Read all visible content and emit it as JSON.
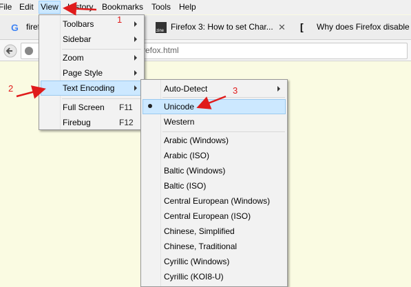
{
  "menubar": {
    "file": "File",
    "edit": "Edit",
    "view": "View",
    "history": "History",
    "bookmarks": "Bookmarks",
    "tools": "Tools",
    "help": "Help"
  },
  "tabs": {
    "t1": "firef",
    "t2": "Firefox 3: How to set Char...",
    "t3": "Why does Firefox disable t"
  },
  "url": {
    "text": "firefox.html"
  },
  "view_menu": {
    "toolbars": "Toolbars",
    "sidebar": "Sidebar",
    "zoom": "Zoom",
    "page_style": "Page Style",
    "text_encoding": "Text Encoding",
    "full_screen": "Full Screen",
    "full_screen_sc": "F11",
    "firebug": "Firebug",
    "firebug_sc": "F12"
  },
  "encoding_menu": {
    "auto_detect": "Auto-Detect",
    "unicode": "Unicode",
    "western": "Western",
    "items": [
      "Arabic (Windows)",
      "Arabic (ISO)",
      "Baltic (Windows)",
      "Baltic (ISO)",
      "Central European (Windows)",
      "Central European (ISO)",
      "Chinese, Simplified",
      "Chinese, Traditional",
      "Cyrillic (Windows)",
      "Cyrillic (KOI8-U)"
    ]
  },
  "annotations": {
    "n1": "1",
    "n2": "2",
    "n3": "3"
  },
  "colors": {
    "highlight": "#cce8ff",
    "annotation": "#e01b1b",
    "page_bg": "#fafbe2"
  }
}
